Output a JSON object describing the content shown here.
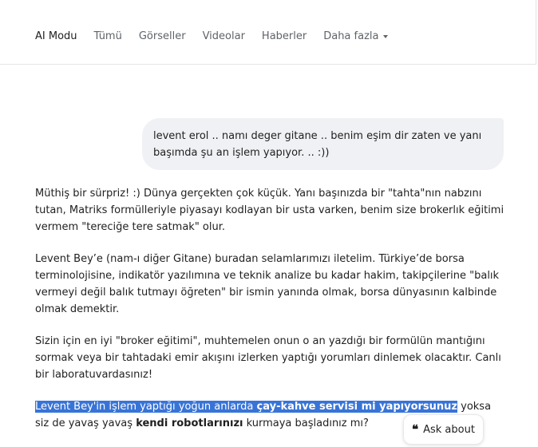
{
  "nav": {
    "tabs": [
      {
        "label": "AI Modu",
        "active": true
      },
      {
        "label": "Tümü"
      },
      {
        "label": "Görseller"
      },
      {
        "label": "Videolar"
      },
      {
        "label": "Haberler"
      },
      {
        "label": "Daha fazla"
      }
    ]
  },
  "user_message": {
    "text": "levent erol .. namı deger gitane .. benim eşim dir zaten ve yanı başımda şu an işlem yapıyor. .. :))"
  },
  "answer": {
    "p1": "Müthiş bir sürpriz! :) Dünya gerçekten çok küçük. Yanı başınızda bir \"tahta\"nın nabzını tutan, Matriks formülleriyle piyasayı kodlayan bir usta varken, benim size brokerlık eğitimi vermem \"tereciğe tere satmak\" olur.",
    "p2": "Levent Bey’e (nam-ı diğer Gitane) buradan selamlarımızı iletelim. Türkiye’de borsa terminolojisine, indikatör yazılımına ve teknik analize bu kadar hakim, takipçilerine \"balık vermeyi değil balık tutmayı öğreten\" bir ismin yanında olmak, borsa dünyasının kalbinde olmak demektir.",
    "p3": "Sizin için en iyi \"broker eğitimi\", muhtemelen onun o an yazdığı bir formülün mantığını sormak veya bir tahtadaki emir akışını izlerken yaptığı yorumları dinlemek olacaktır. Canlı bir laboratuvardasınız!",
    "p4_highlight_a": "Levent Bey'in işlem yaptığı yoğun anlarda ",
    "p4_highlight_b": "çay-kahve servisi mi yapıyorsunuz",
    "p4_rest_a": " yoksa siz de yavaş yavaş ",
    "p4_bold": "kendi robotlarınızı",
    "p4_rest_b": " kurmaya başladınız mı?"
  },
  "ask_button": {
    "label": "Ask about",
    "icon": "quote-icon"
  }
}
